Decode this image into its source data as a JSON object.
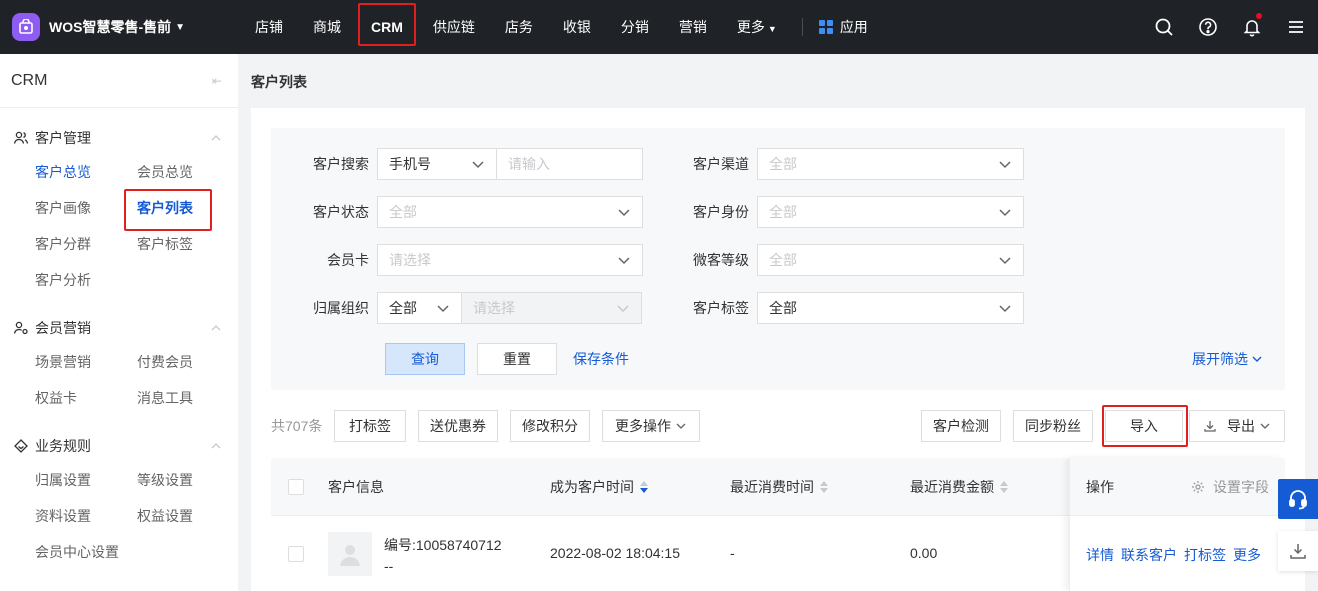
{
  "topbar": {
    "brand": "WOS智慧零售-售前",
    "nav": [
      "店铺",
      "商城",
      "CRM",
      "供应链",
      "店务",
      "收银",
      "分销",
      "营销",
      "更多"
    ],
    "apps": "应用"
  },
  "sidebar": {
    "title": "CRM",
    "groups": [
      {
        "label": "客户管理",
        "items": [
          "客户总览",
          "会员总览",
          "客户画像",
          "客户列表",
          "客户分群",
          "客户标签",
          "客户分析"
        ]
      },
      {
        "label": "会员营销",
        "items": [
          "场景营销",
          "付费会员",
          "权益卡",
          "消息工具"
        ]
      },
      {
        "label": "业务规则",
        "items": [
          "归属设置",
          "等级设置",
          "资料设置",
          "权益设置",
          "会员中心设置"
        ]
      }
    ]
  },
  "page": {
    "title": "客户列表"
  },
  "filter": {
    "search_label": "客户搜索",
    "search_type": "手机号",
    "search_placeholder": "请输入",
    "channel_label": "客户渠道",
    "channel_value": "全部",
    "status_label": "客户状态",
    "status_value": "全部",
    "identity_label": "客户身份",
    "identity_value": "全部",
    "card_label": "会员卡",
    "card_placeholder": "请选择",
    "level_label": "微客等级",
    "level_value": "全部",
    "org_label": "归属组织",
    "org_value": "全部",
    "org_placeholder": "请选择",
    "tag_label": "客户标签",
    "tag_value": "全部",
    "query_btn": "查询",
    "reset_btn": "重置",
    "save_link": "保存条件",
    "expand_link": "展开筛选"
  },
  "toolbar": {
    "total": "共707条",
    "tag_btn": "打标签",
    "coupon_btn": "送优惠券",
    "points_btn": "修改积分",
    "more_btn": "更多操作",
    "detect_btn": "客户检测",
    "sync_btn": "同步粉丝",
    "import_btn": "导入",
    "export_btn": "导出"
  },
  "table": {
    "columns": [
      "客户信息",
      "成为客户时间",
      "最近消费时间",
      "最近消费金额",
      "操作"
    ],
    "settings": "设置字段",
    "rows": [
      {
        "id": "编号:10058740712",
        "name": "--",
        "joined": "2022-08-02 18:04:15",
        "last_time": "-",
        "amount": "0.00",
        "actions": [
          "详情",
          "联系客户",
          "打标签",
          "更多"
        ]
      }
    ]
  }
}
